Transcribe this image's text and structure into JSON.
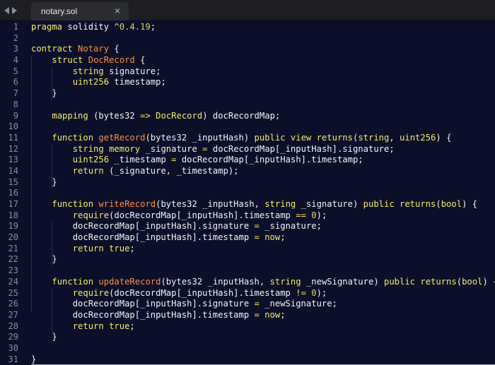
{
  "tab": {
    "title": "notary.sol",
    "close_glyph": "×"
  },
  "editor": {
    "line_numbers": [
      "1",
      "2",
      "3",
      "4",
      "5",
      "6",
      "7",
      "8",
      "9",
      "10",
      "11",
      "12",
      "13",
      "14",
      "15",
      "16",
      "17",
      "18",
      "19",
      "20",
      "21",
      "22",
      "23",
      "24",
      "25",
      "26",
      "27",
      "28",
      "29",
      "30",
      "31"
    ],
    "lines": [
      [
        [
          "kw",
          "pragma"
        ],
        [
          "plain",
          " solidity "
        ],
        [
          "op",
          "^"
        ],
        [
          "num",
          "0.4.19"
        ],
        [
          "plain",
          ";"
        ]
      ],
      [],
      [
        [
          "kw",
          "contract"
        ],
        [
          "plain",
          " "
        ],
        [
          "name",
          "Notary"
        ],
        [
          "plain",
          " {"
        ]
      ],
      [
        [
          "plain",
          "    "
        ],
        [
          "kw",
          "struct"
        ],
        [
          "plain",
          " "
        ],
        [
          "name",
          "DocRecord"
        ],
        [
          "plain",
          " {"
        ]
      ],
      [
        [
          "plain",
          "        "
        ],
        [
          "ty",
          "string"
        ],
        [
          "plain",
          " signature;"
        ]
      ],
      [
        [
          "plain",
          "        "
        ],
        [
          "ty",
          "uint256"
        ],
        [
          "plain",
          " timestamp;"
        ]
      ],
      [
        [
          "plain",
          "    }"
        ]
      ],
      [],
      [
        [
          "plain",
          "    "
        ],
        [
          "kw",
          "mapping"
        ],
        [
          "plain",
          " (bytes32 "
        ],
        [
          "op",
          "=>"
        ],
        [
          "plain",
          " "
        ],
        [
          "ty",
          "DocRecord"
        ],
        [
          "plain",
          ") docRecordMap;"
        ]
      ],
      [],
      [
        [
          "plain",
          "    "
        ],
        [
          "kw",
          "function"
        ],
        [
          "plain",
          " "
        ],
        [
          "name",
          "getRecord"
        ],
        [
          "plain",
          "(bytes32 _inputHash) "
        ],
        [
          "kw",
          "public view returns"
        ],
        [
          "plain",
          "("
        ],
        [
          "ty",
          "string"
        ],
        [
          "plain",
          ", "
        ],
        [
          "ty",
          "uint256"
        ],
        [
          "plain",
          ") {"
        ]
      ],
      [
        [
          "plain",
          "        "
        ],
        [
          "ty",
          "string"
        ],
        [
          "plain",
          " "
        ],
        [
          "kw",
          "memory"
        ],
        [
          "plain",
          " _signature "
        ],
        [
          "op",
          "="
        ],
        [
          "plain",
          " docRecordMap[_inputHash].signature;"
        ]
      ],
      [
        [
          "plain",
          "        "
        ],
        [
          "ty",
          "uint256"
        ],
        [
          "plain",
          " _timestamp "
        ],
        [
          "op",
          "="
        ],
        [
          "plain",
          " docRecordMap[_inputHash].timestamp;"
        ]
      ],
      [
        [
          "plain",
          "        "
        ],
        [
          "kw",
          "return"
        ],
        [
          "plain",
          " (_signature, _timestamp);"
        ]
      ],
      [
        [
          "plain",
          "    }"
        ]
      ],
      [],
      [
        [
          "plain",
          "    "
        ],
        [
          "kw",
          "function"
        ],
        [
          "plain",
          " "
        ],
        [
          "name",
          "writeRecord"
        ],
        [
          "plain",
          "(bytes32 _inputHash, "
        ],
        [
          "ty",
          "string"
        ],
        [
          "plain",
          " _signature) "
        ],
        [
          "kw",
          "public returns"
        ],
        [
          "plain",
          "("
        ],
        [
          "ty",
          "bool"
        ],
        [
          "plain",
          ") {"
        ]
      ],
      [
        [
          "plain",
          "        "
        ],
        [
          "kw",
          "require"
        ],
        [
          "plain",
          "(docRecordMap[_inputHash].timestamp "
        ],
        [
          "op",
          "=="
        ],
        [
          "plain",
          " "
        ],
        [
          "num",
          "0"
        ],
        [
          "plain",
          ");"
        ]
      ],
      [
        [
          "plain",
          "        docRecordMap[_inputHash].signature "
        ],
        [
          "op",
          "="
        ],
        [
          "plain",
          " _signature;"
        ]
      ],
      [
        [
          "plain",
          "        docRecordMap[_inputHash].timestamp "
        ],
        [
          "op",
          "="
        ],
        [
          "plain",
          " "
        ],
        [
          "kw",
          "now"
        ],
        [
          "plain",
          ";"
        ]
      ],
      [
        [
          "plain",
          "        "
        ],
        [
          "kw",
          "return"
        ],
        [
          "plain",
          " "
        ],
        [
          "kw",
          "true"
        ],
        [
          "plain",
          ";"
        ]
      ],
      [
        [
          "plain",
          "    }"
        ]
      ],
      [],
      [
        [
          "plain",
          "    "
        ],
        [
          "kw",
          "function"
        ],
        [
          "plain",
          " "
        ],
        [
          "name",
          "updateRecord"
        ],
        [
          "plain",
          "(bytes32 _inputHash, "
        ],
        [
          "ty",
          "string"
        ],
        [
          "plain",
          " _newSignature) "
        ],
        [
          "kw",
          "public returns"
        ],
        [
          "plain",
          "("
        ],
        [
          "ty",
          "bool"
        ],
        [
          "plain",
          ") {"
        ]
      ],
      [
        [
          "plain",
          "        "
        ],
        [
          "kw",
          "require"
        ],
        [
          "plain",
          "(docRecordMap[_inputHash].timestamp "
        ],
        [
          "op",
          "!="
        ],
        [
          "plain",
          " "
        ],
        [
          "num",
          "0"
        ],
        [
          "plain",
          ");"
        ]
      ],
      [
        [
          "plain",
          "        docRecordMap[_inputHash].signature "
        ],
        [
          "op",
          "="
        ],
        [
          "plain",
          " _newSignature;"
        ]
      ],
      [
        [
          "plain",
          "        docRecordMap[_inputHash].timestamp "
        ],
        [
          "op",
          "="
        ],
        [
          "plain",
          " "
        ],
        [
          "kw",
          "now"
        ],
        [
          "plain",
          ";"
        ]
      ],
      [
        [
          "plain",
          "        "
        ],
        [
          "kw",
          "return"
        ],
        [
          "plain",
          " "
        ],
        [
          "kw",
          "true"
        ],
        [
          "plain",
          ";"
        ]
      ],
      [
        [
          "plain",
          "    }"
        ]
      ],
      [],
      [
        [
          "plain",
          "}"
        ]
      ]
    ]
  },
  "icons": {
    "nav_back": "chevron-left-icon",
    "nav_forward": "chevron-right-icon",
    "tab_close": "close-icon"
  },
  "colors": {
    "background": "#0b0f2a",
    "tabbar": "#1c1e23",
    "active_tab": "#2a2c32",
    "gutter_text": "#8b8f98",
    "keyword": "#f7ea6a",
    "type": "#f7ea6a",
    "name": "#ff8f3d",
    "plain": "#f4f4f4"
  }
}
